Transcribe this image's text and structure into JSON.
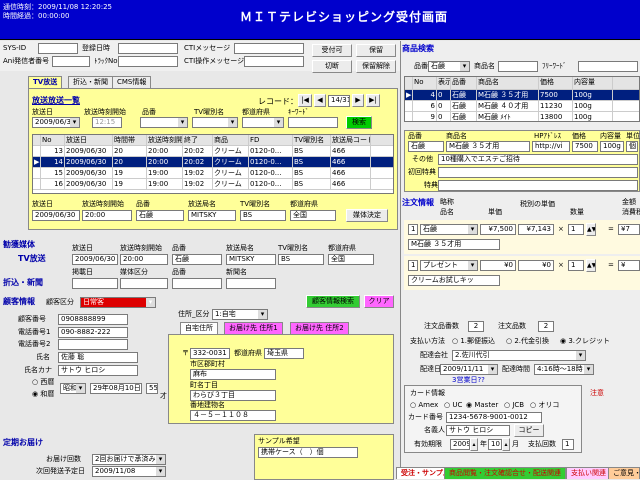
{
  "header": {
    "time1": "通信時刻：2009/11/08 12:20:25",
    "time2": "時間経過：00:00:00",
    "title": "ＭＩＴテレビショッピング受付画面"
  },
  "top": {
    "sysid_label": "SYS-ID",
    "accept_date_label": "登録日時",
    "ani_label": "Ani発信者番号",
    "tracking_label": "ﾄﾗｯｸNo",
    "cti_msg_label": "CTIメッセージ",
    "cti_op_label": "CTI操作メッセージ",
    "btn_accept": "受付可",
    "btn_hold": "保留",
    "btn_cut": "切断",
    "btn_release": "保留解除"
  },
  "tabs": {
    "tv": "TV放送",
    "news": "折込・新聞",
    "cms": "CMS情報"
  },
  "broadcast": {
    "title": "放送放送一覧",
    "date_label": "放送日",
    "date_val": "2009/06/30",
    "time_label": "放送時刻開始",
    "time_val": "12:15",
    "item_label": "品番",
    "tv_label": "TV曜別名",
    "pref_label": "都道府県",
    "kw_label": "ｷｰﾜｰﾄﾞ",
    "record_label": "レコード：",
    "record_val": "14/31",
    "search_btn": "検索",
    "columns": [
      "No",
      "放送日",
      "時間帯",
      "放送時刻開始",
      "終了",
      "商品",
      "FD",
      "TV曜別名",
      "放送局コード"
    ],
    "rows": [
      [
        "13",
        "2009/06/30",
        "20",
        "20:00",
        "20:02",
        "クリーム",
        "0120-0...",
        "BS",
        "466"
      ],
      [
        "14",
        "2009/06/30",
        "20",
        "20:00",
        "20:02",
        "クリーム",
        "0120-0...",
        "BS",
        "466"
      ],
      [
        "15",
        "2009/06/30",
        "19",
        "19:00",
        "19:02",
        "クリーム",
        "0120-0...",
        "BS",
        "466"
      ],
      [
        "16",
        "2009/06/30",
        "19",
        "19:00",
        "19:02",
        "クリーム",
        "0120-0...",
        "BS",
        "466"
      ]
    ],
    "sel_labels": [
      "放送日",
      "放送時刻開始",
      "品番",
      "放送局名",
      "TV曜別名",
      "都道府県"
    ],
    "sel_vals": [
      "2009/06/30",
      "20:00",
      "石鹸",
      "MITSKY",
      "BS",
      "全国"
    ],
    "decide_btn": "媒体決定"
  },
  "media": {
    "title": "勧獲媒体",
    "tv": "TV放送",
    "news": "折込・新聞",
    "labels": [
      "放送日",
      "放送時刻開始",
      "品番",
      "放送局名",
      "TV曜別名",
      "都道府県"
    ],
    "vals": [
      "2009/06/30",
      "20:00",
      "石鹸",
      "MITSKY",
      "BS",
      "全国"
    ],
    "labels2": [
      "掲載日",
      "媒体区分",
      "品番",
      "新聞名"
    ]
  },
  "customer": {
    "title": "顧客情報",
    "kubun_label": "顧客区分",
    "kubun_val": "日常客",
    "phone_label": "顧客番号",
    "phone_val": "0908888899",
    "tel1_label": "電話番号1",
    "tel1_val": "090-8882-222",
    "tel2_label": "電話番号2",
    "name_label": "氏名",
    "name_val": "佐藤 聡",
    "kana_label": "氏名カナ",
    "kana_val": "サトウ ヒロシ",
    "era1": "西暦",
    "era2": "和暦",
    "era_sel": "昭和",
    "birth_val": "29年08月10日",
    "age_val": "55",
    "age_unit": "才",
    "search_btn": "顧客情報検索",
    "clear_btn": "クリア",
    "addr_kubun_label": "住所_区分",
    "addr_kubun_val": "1:自宅",
    "addr_tabs": [
      "自宅住所",
      "お届け先 住所1",
      "お届け先 住所2"
    ],
    "zip_val": "332-0031",
    "pref_label": "都道府県",
    "pref_val": "埼玉県",
    "city_label": "市区郡町村",
    "city_val": "麻布",
    "town_label": "町名丁目",
    "town_val": "わらび３丁目",
    "bldg_label": "番地建物名",
    "bldg_val": "４－５－１１０８"
  },
  "regular": {
    "title": "定期お届け",
    "cycle_label": "お届け回数",
    "cycle_val": "2回お届けで承済み",
    "next_label": "次回発送予定日",
    "next_val": "2009/11/08",
    "sample_label": "サンプル希望",
    "sample_val": "携帯ケース（　）個"
  },
  "product_search": {
    "title": "商品検索",
    "item_label": "品番",
    "item_val": "石鹸",
    "name_label": "商品名",
    "free_label": "ﾌﾘｰﾜｰﾄﾞ",
    "columns": [
      "No",
      "表示",
      "品番",
      "商品名",
      "価格",
      "内容量"
    ],
    "rows": [
      [
        "4",
        "0",
        "石鹸",
        "M石鹸 ３５才用",
        "7500",
        "100g"
      ],
      [
        "6",
        "0",
        "石鹸",
        "M石鹸 ４０才用",
        "11230",
        "100g"
      ],
      [
        "9",
        "0",
        "石鹸",
        "M石鹸 ﾒｲﾄ",
        "13800",
        "100g"
      ]
    ],
    "detail_labels": [
      "品番",
      "商品名",
      "HPｱﾄﾞﾚｽ",
      "価格",
      "内容量",
      "単位"
    ],
    "detail_vals": [
      "石鹸",
      "M石鹸 ３５才用",
      "http://vi",
      "7500",
      "100g",
      "個"
    ],
    "other_label": "その他",
    "other_val": "10種購入でエステご招待",
    "first_label": "初回特典",
    "special_label": "特典"
  },
  "order": {
    "title": "注文情報",
    "cols": [
      "略称",
      "品名",
      "単価",
      "税別の単価",
      "数量",
      "金額",
      "消費税"
    ],
    "row1_no": "1",
    "row1_item": "石鹸",
    "row1_price": "¥7,500",
    "row1_tax": "¥7,143",
    "row1_qty": "1",
    "row1_amt": "¥7",
    "row1_name": "M石鹸 ３５才用",
    "row2_no": "1",
    "row2_item": "プレゼント",
    "row2_price": "¥0",
    "row2_tax": "¥0",
    "row2_qty": "1",
    "row2_amt": "¥",
    "row2_name": "クリームお試しキッ",
    "total_count_label": "注文品番数",
    "total_count": "2",
    "total_qty_label": "注文品数",
    "total_qty": "2",
    "pay_label": "支払い方法",
    "pay1": "1.郵便振込",
    "pay2": "2.代金引換",
    "pay3": "3.クレジット",
    "deliv_co_label": "配達会社",
    "deliv_co_val": "2.佐川代引",
    "deliv_date_label": "配達日",
    "deliv_date_val": "2009/11/11",
    "deliv_time_label": "配達時間",
    "deliv_time_val": "4:16時～18時",
    "holiday_label": "3営業日??",
    "card_title": "カード情報",
    "card_types": [
      "Amex",
      "UC",
      "Master",
      "JCB",
      "オリコ"
    ],
    "card_no_label": "カード番号",
    "card_no_val": "1234-5678-9001-0012",
    "card_name_label": "名義人",
    "card_name_val": "サトウ ヒロシ",
    "copy_btn": "コピー",
    "expiry_label": "有効期限",
    "expiry_year": "2009",
    "expiry_year_unit": "年",
    "expiry_month": "10",
    "expiry_month_unit": "月",
    "pay_count_label": "支払回数",
    "pay_count_val": "1",
    "caution": "注意"
  },
  "bottom_tabs": [
    "受注・サンプル",
    "商品閲覧・注文確認合せ・配送関連",
    "支払い関連",
    "ご意見・..."
  ]
}
